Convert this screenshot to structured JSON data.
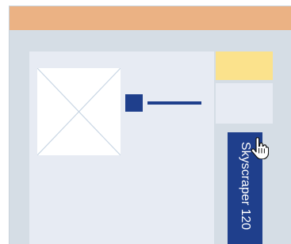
{
  "banner": {
    "label": "Skyscraper 120"
  },
  "icons": {
    "image_placeholder": "image-placeholder-icon",
    "cursor": "hand-pointer-cursor-icon"
  },
  "colors": {
    "titlebar": "#ebb284",
    "frame_background": "#d5dde5",
    "panel": "#e7ebf3",
    "accent": "#1f3f8c",
    "highlight": "#fbe28c"
  }
}
